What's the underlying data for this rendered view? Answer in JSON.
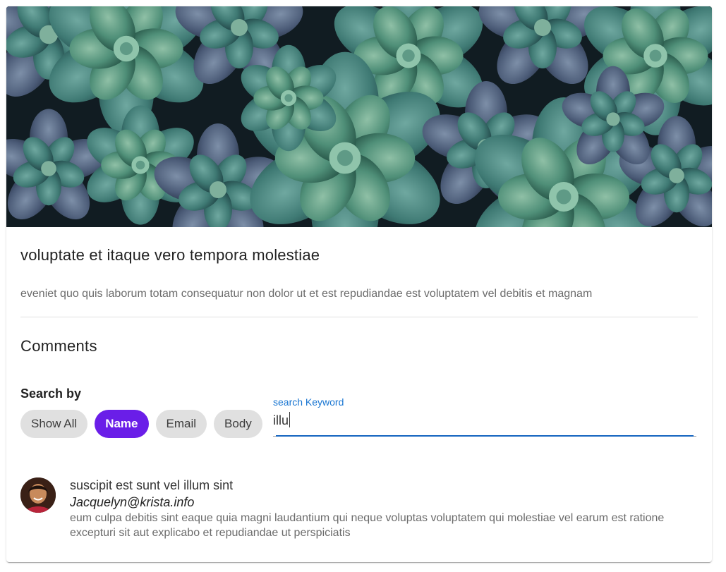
{
  "post": {
    "image_alt": "succulent-plants-photo",
    "title": "voluptate et itaque vero tempora molestiae",
    "body": "eveniet quo quis laborum totam consequatur non dolor ut et est repudiandae est voluptatem vel debitis et magnam"
  },
  "comments_section": {
    "heading": "Comments",
    "search_by_label": "Search by",
    "filters": [
      {
        "label": "Show All",
        "active": false
      },
      {
        "label": "Name",
        "active": true
      },
      {
        "label": "Email",
        "active": false
      },
      {
        "label": "Body",
        "active": false
      }
    ],
    "keyword": {
      "label": "search Keyword",
      "value": "illu"
    },
    "accent_color": "#6a1ee8",
    "focus_color": "#1565c0"
  },
  "comments": [
    {
      "name": "suscipit est sunt vel illum sint",
      "email": "Jacquelyn@krista.info",
      "body": "eum culpa debitis sint eaque quia magni laudantium qui neque voluptas voluptatem qui molestiae vel earum est ratione excepturi sit aut explicabo et repudiandae ut perspiciatis",
      "avatar": "user-avatar"
    }
  ]
}
